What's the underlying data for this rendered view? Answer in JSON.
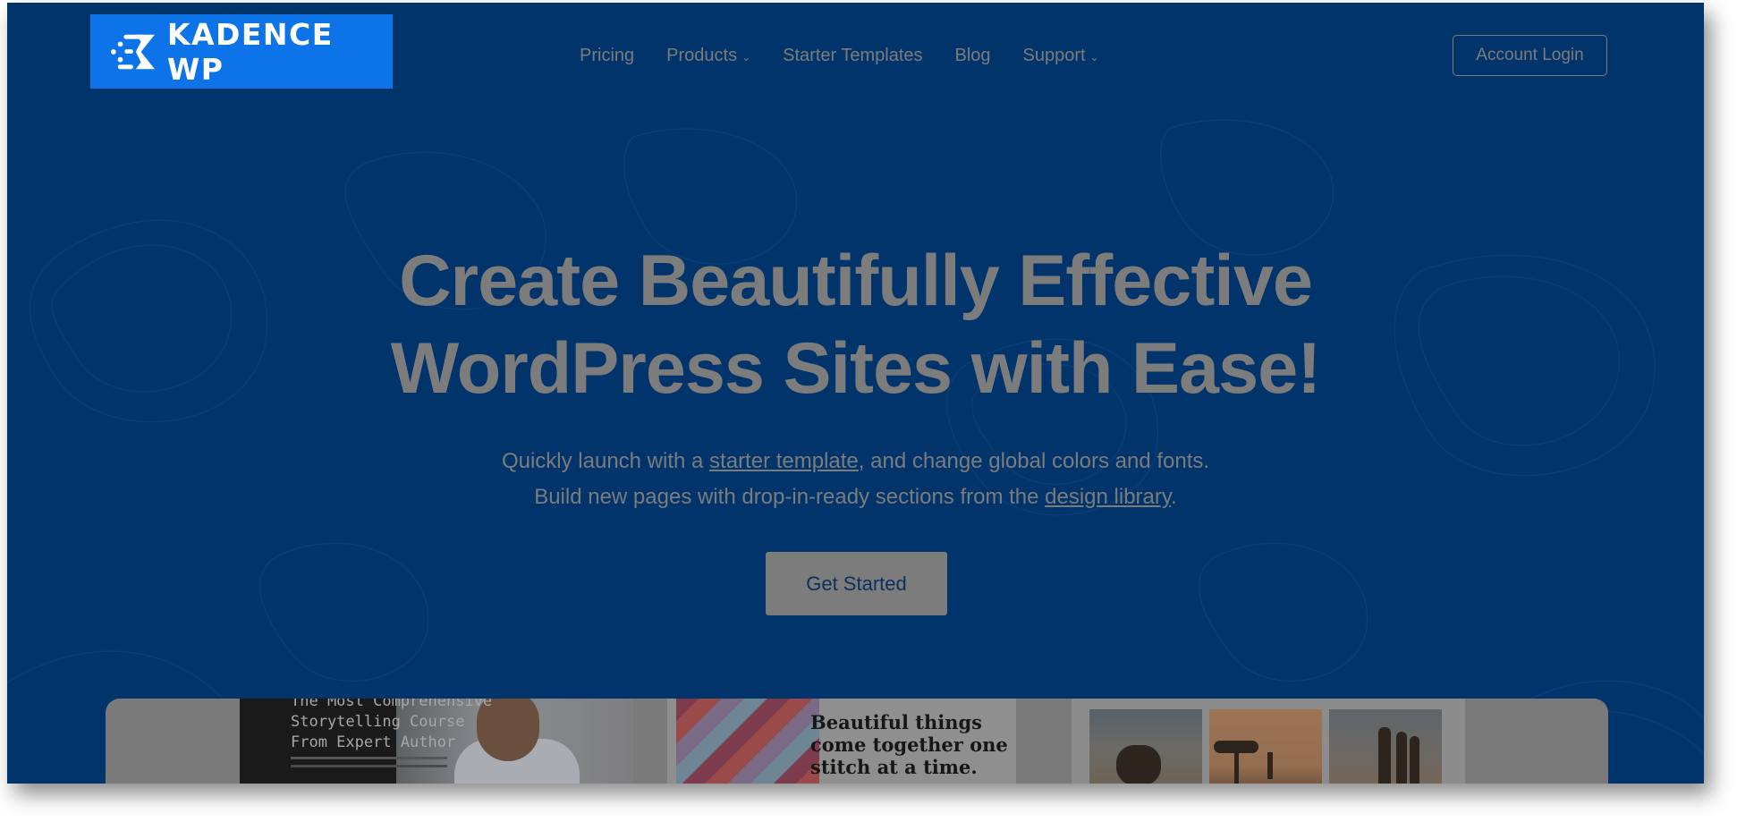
{
  "brand": {
    "name": "KADENCE WP",
    "logo_icon": "kadence-k-icon",
    "logo_bg": "#0d73e8",
    "page_bg": "#01346b"
  },
  "nav": {
    "items": [
      {
        "label": "Pricing",
        "has_dropdown": false
      },
      {
        "label": "Products",
        "has_dropdown": true
      },
      {
        "label": "Starter Templates",
        "has_dropdown": false
      },
      {
        "label": "Blog",
        "has_dropdown": false
      },
      {
        "label": "Support",
        "has_dropdown": true
      }
    ],
    "dropdown_glyph": "⌄",
    "account_login": "Account Login"
  },
  "hero": {
    "title_line1": "Create Beautifully Effective",
    "title_line2": "WordPress Sites with Ease!",
    "sub_line1_pre": "Quickly launch with a ",
    "sub_line1_link": "starter template",
    "sub_line1_post": ", and change global colors and fonts.",
    "sub_line2_pre": "Build new pages with drop-in-ready sections from the ",
    "sub_line2_link": "design library",
    "sub_line2_post": ".",
    "cta_label": "Get Started"
  },
  "showcase": {
    "card1": {
      "lines": [
        "The Most Comprehensive",
        "Storytelling Course",
        "From Expert Author"
      ]
    },
    "card2": {
      "lines": [
        "Beautiful things",
        "come together one",
        "stitch at a time."
      ]
    },
    "card3": {
      "thumbs": [
        "motorcycle-desert-photo",
        "giraffe-savanna-photo",
        "people-carrying-water-photo"
      ]
    }
  }
}
